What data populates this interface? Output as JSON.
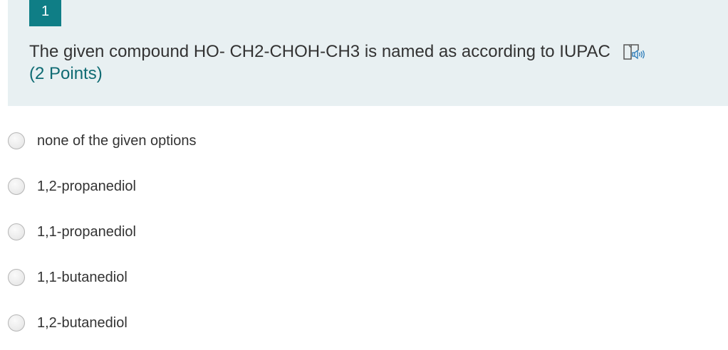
{
  "question": {
    "number": "1",
    "title": "The given compound  HO- CH2-CHOH-CH3 is named as according to IUPAC",
    "points": "(2 Points)",
    "reader_icon": "immersive-reader-icon",
    "header_bg": "#e8f0f2",
    "accent": "#0f7e86"
  },
  "options": [
    {
      "label": "none of the given options"
    },
    {
      "label": "1,2-propanediol"
    },
    {
      "label": "1,1-propanediol"
    },
    {
      "label": "1,1-butanediol"
    },
    {
      "label": "1,2-butanediol"
    }
  ]
}
